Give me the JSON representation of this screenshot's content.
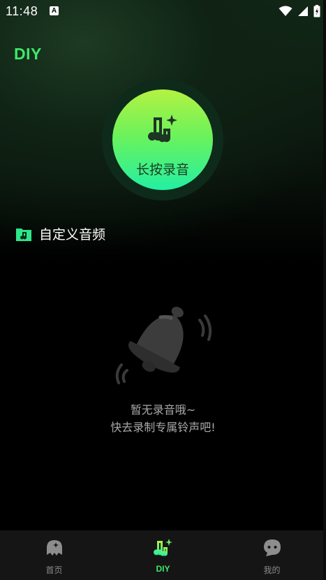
{
  "status_bar": {
    "time": "11:48",
    "notification_icon": "A"
  },
  "header": {
    "title": "DIY"
  },
  "record": {
    "label": "长按录音",
    "icon": "music-sparkle-icon"
  },
  "section": {
    "title": "自定义音频",
    "icon": "music-folder-icon"
  },
  "empty_state": {
    "line1": "暂无录音哦~",
    "line2": "快去录制专属铃声吧!",
    "icon": "bell-icon"
  },
  "tab_bar": {
    "tabs": [
      {
        "label": "首页",
        "icon": "ghost-icon",
        "active": false
      },
      {
        "label": "DIY",
        "icon": "music-sparkle-icon",
        "active": true
      },
      {
        "label": "我的",
        "icon": "chat-bubble-icon",
        "active": false
      }
    ]
  },
  "colors": {
    "accent": "#3ee86a",
    "record_gradient_top": "#b4f242",
    "record_gradient_bottom": "#22f0a2",
    "tab_bar_bg": "#151515",
    "empty_text": "#a8a8a8"
  }
}
